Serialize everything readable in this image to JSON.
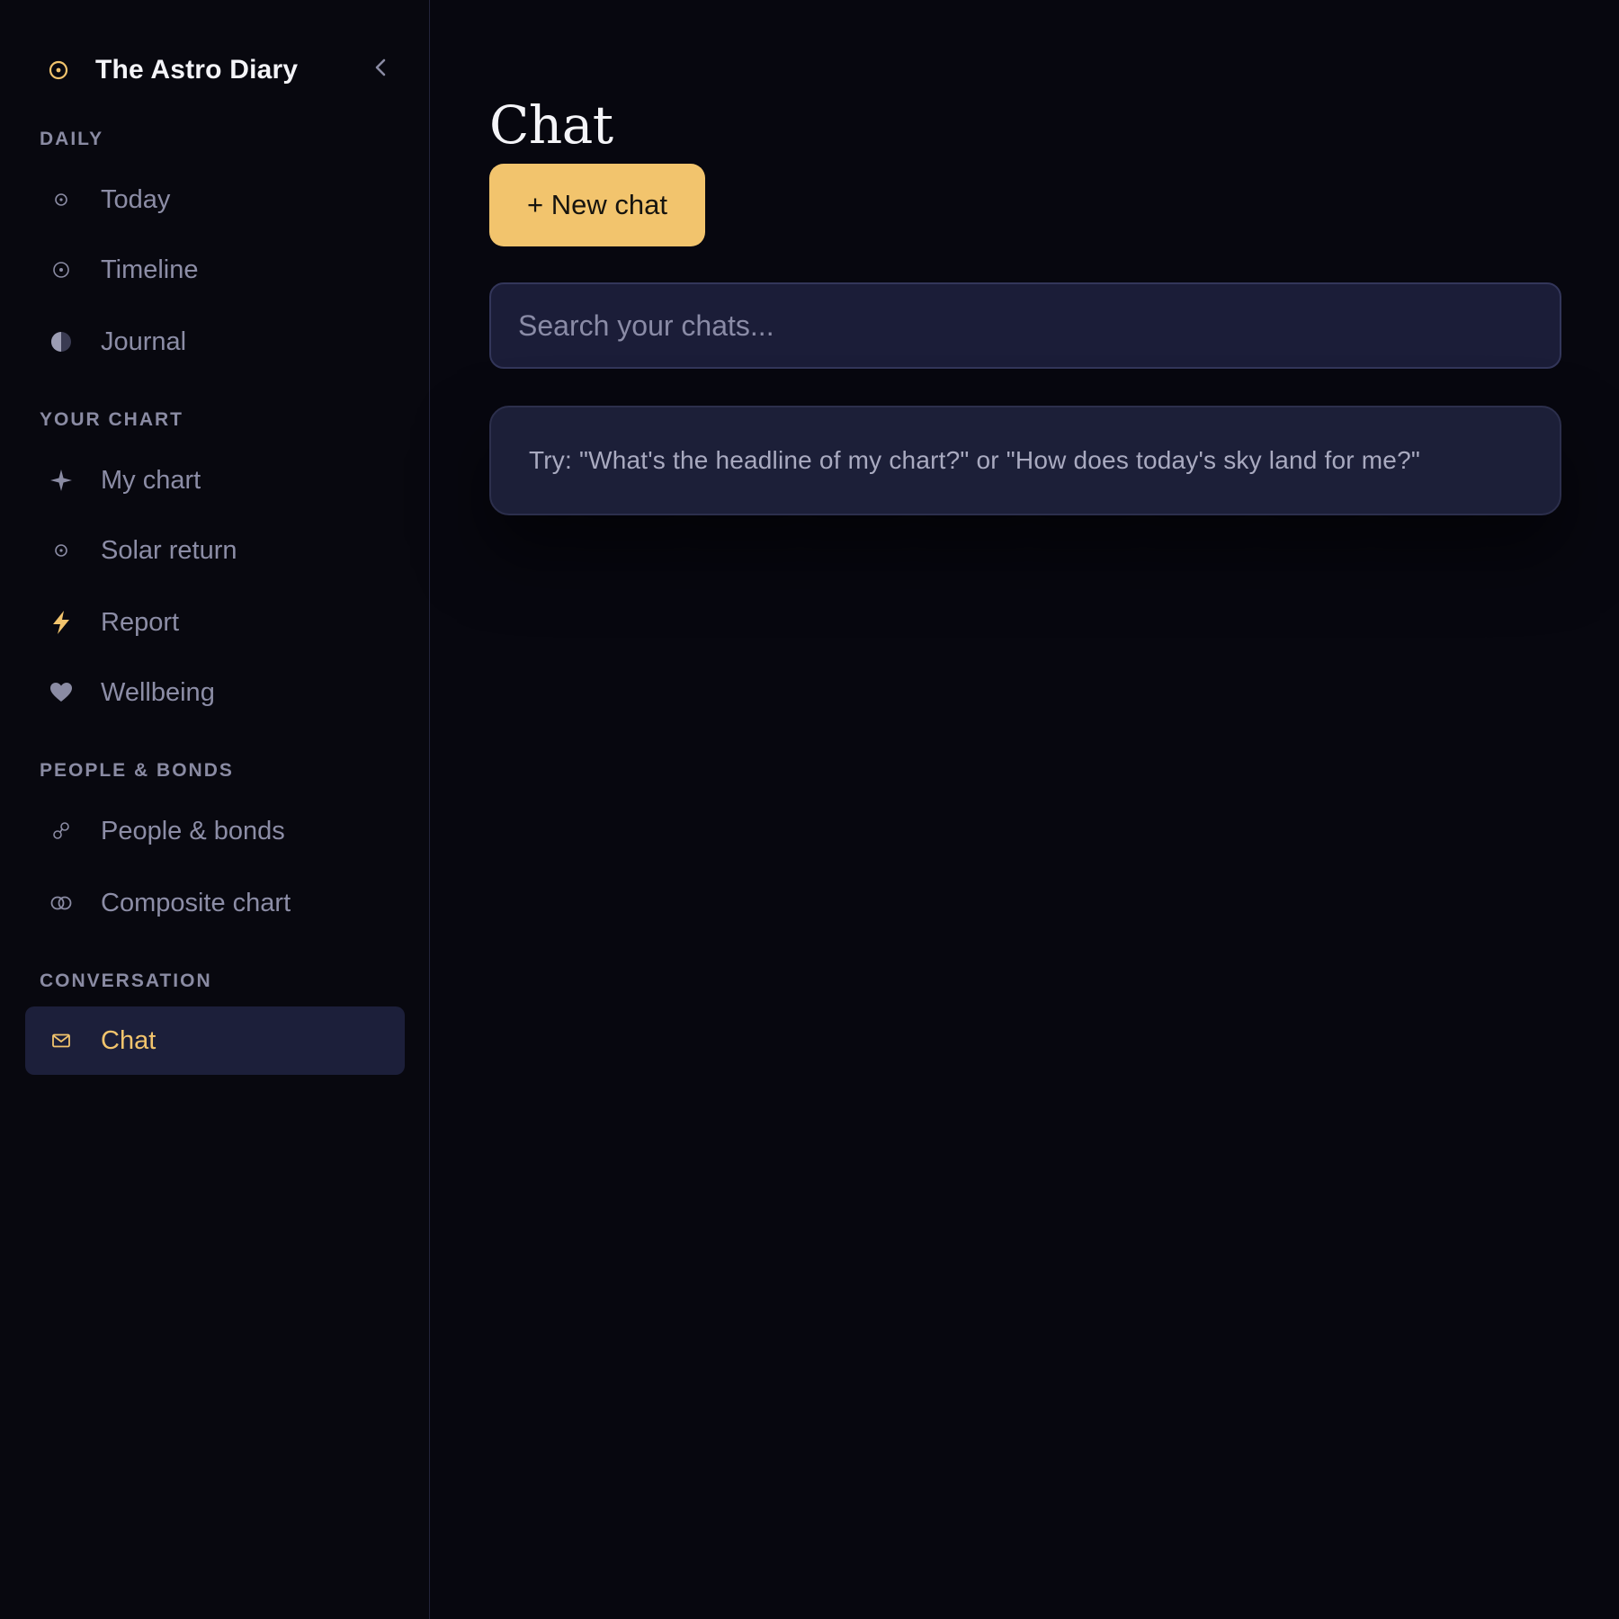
{
  "brand": {
    "title": "The Astro Diary",
    "icon": "sun-circle-icon",
    "accent_color": "#f2c46d"
  },
  "sidebar": {
    "collapse_icon": "chevron-left-icon",
    "sections": [
      {
        "label": "DAILY",
        "items": [
          {
            "label": "Today",
            "icon": "dot-circle-icon"
          },
          {
            "label": "Timeline",
            "icon": "dot-circle-icon"
          },
          {
            "label": "Journal",
            "icon": "half-moon-icon"
          }
        ]
      },
      {
        "label": "YOUR CHART",
        "items": [
          {
            "label": "My chart",
            "icon": "sparkle-icon"
          },
          {
            "label": "Solar return",
            "icon": "dot-circle-icon"
          },
          {
            "label": "Report",
            "icon": "lightning-icon"
          },
          {
            "label": "Wellbeing",
            "icon": "heart-icon"
          }
        ]
      },
      {
        "label": "PEOPLE & BONDS",
        "items": [
          {
            "label": "People & bonds",
            "icon": "linked-circles-icon"
          },
          {
            "label": "Composite chart",
            "icon": "overlap-circles-icon"
          }
        ]
      },
      {
        "label": "CONVERSATION",
        "items": [
          {
            "label": "Chat",
            "icon": "envelope-icon",
            "active": true
          }
        ]
      }
    ]
  },
  "main": {
    "title": "Chat",
    "new_chat_label": "+ New chat",
    "search": {
      "placeholder": "Search your chats...",
      "value": ""
    },
    "hint": "Try: \"What's the headline of my chart?\" or \"How does today's sky land for me?\""
  },
  "colors": {
    "background": "#07070f",
    "active_bg": "#1c1f3a",
    "muted_text": "#8c8da6",
    "button_bg": "#f2c46d"
  }
}
